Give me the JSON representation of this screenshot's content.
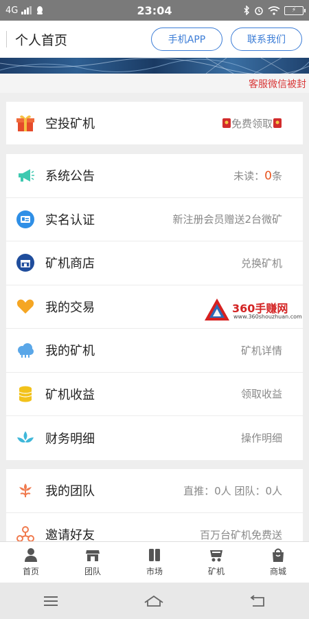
{
  "status_bar": {
    "network": "4G",
    "time": "23:04",
    "battery": ""
  },
  "header": {
    "title": "个人首页",
    "app_button": "手机APP",
    "contact_button": "联系我们"
  },
  "notice": {
    "text": "客服微信被封"
  },
  "airdrop": {
    "label": "空投矿机",
    "value": "免费领取"
  },
  "menu": [
    {
      "label": "系统公告",
      "value_prefix": "未读：",
      "value_num": "0",
      "value_suffix": "条",
      "icon": "megaphone-icon"
    },
    {
      "label": "实名认证",
      "value": "新注册会员赠送2台微矿",
      "icon": "id-card-icon"
    },
    {
      "label": "矿机商店",
      "value": "兑换矿机",
      "icon": "store-icon"
    },
    {
      "label": "我的交易",
      "value": "",
      "icon": "heart-icon"
    },
    {
      "label": "我的矿机",
      "value": "矿机详情",
      "icon": "cloud-icon"
    },
    {
      "label": "矿机收益",
      "value": "领取收益",
      "icon": "coins-icon"
    },
    {
      "label": "财务明细",
      "value": "操作明细",
      "icon": "lotus-icon"
    }
  ],
  "team": [
    {
      "label": "我的团队",
      "value": "直推：0人 团队：0人",
      "icon": "flower-icon"
    },
    {
      "label": "邀请好友",
      "value": "百万台矿机免费送",
      "icon": "invite-icon"
    }
  ],
  "watermark": {
    "name": "360手赚网",
    "url": "www.360shouzhuan.com"
  },
  "tabs": [
    {
      "label": "首页",
      "icon": "person-icon"
    },
    {
      "label": "团队",
      "icon": "shop-icon"
    },
    {
      "label": "市场",
      "icon": "market-icon"
    },
    {
      "label": "矿机",
      "icon": "miner-icon"
    },
    {
      "label": "商城",
      "icon": "bag-icon"
    }
  ],
  "colors": {
    "accent": "#3b7cd6",
    "alert": "#d93838",
    "highlight": "#e8541e"
  }
}
